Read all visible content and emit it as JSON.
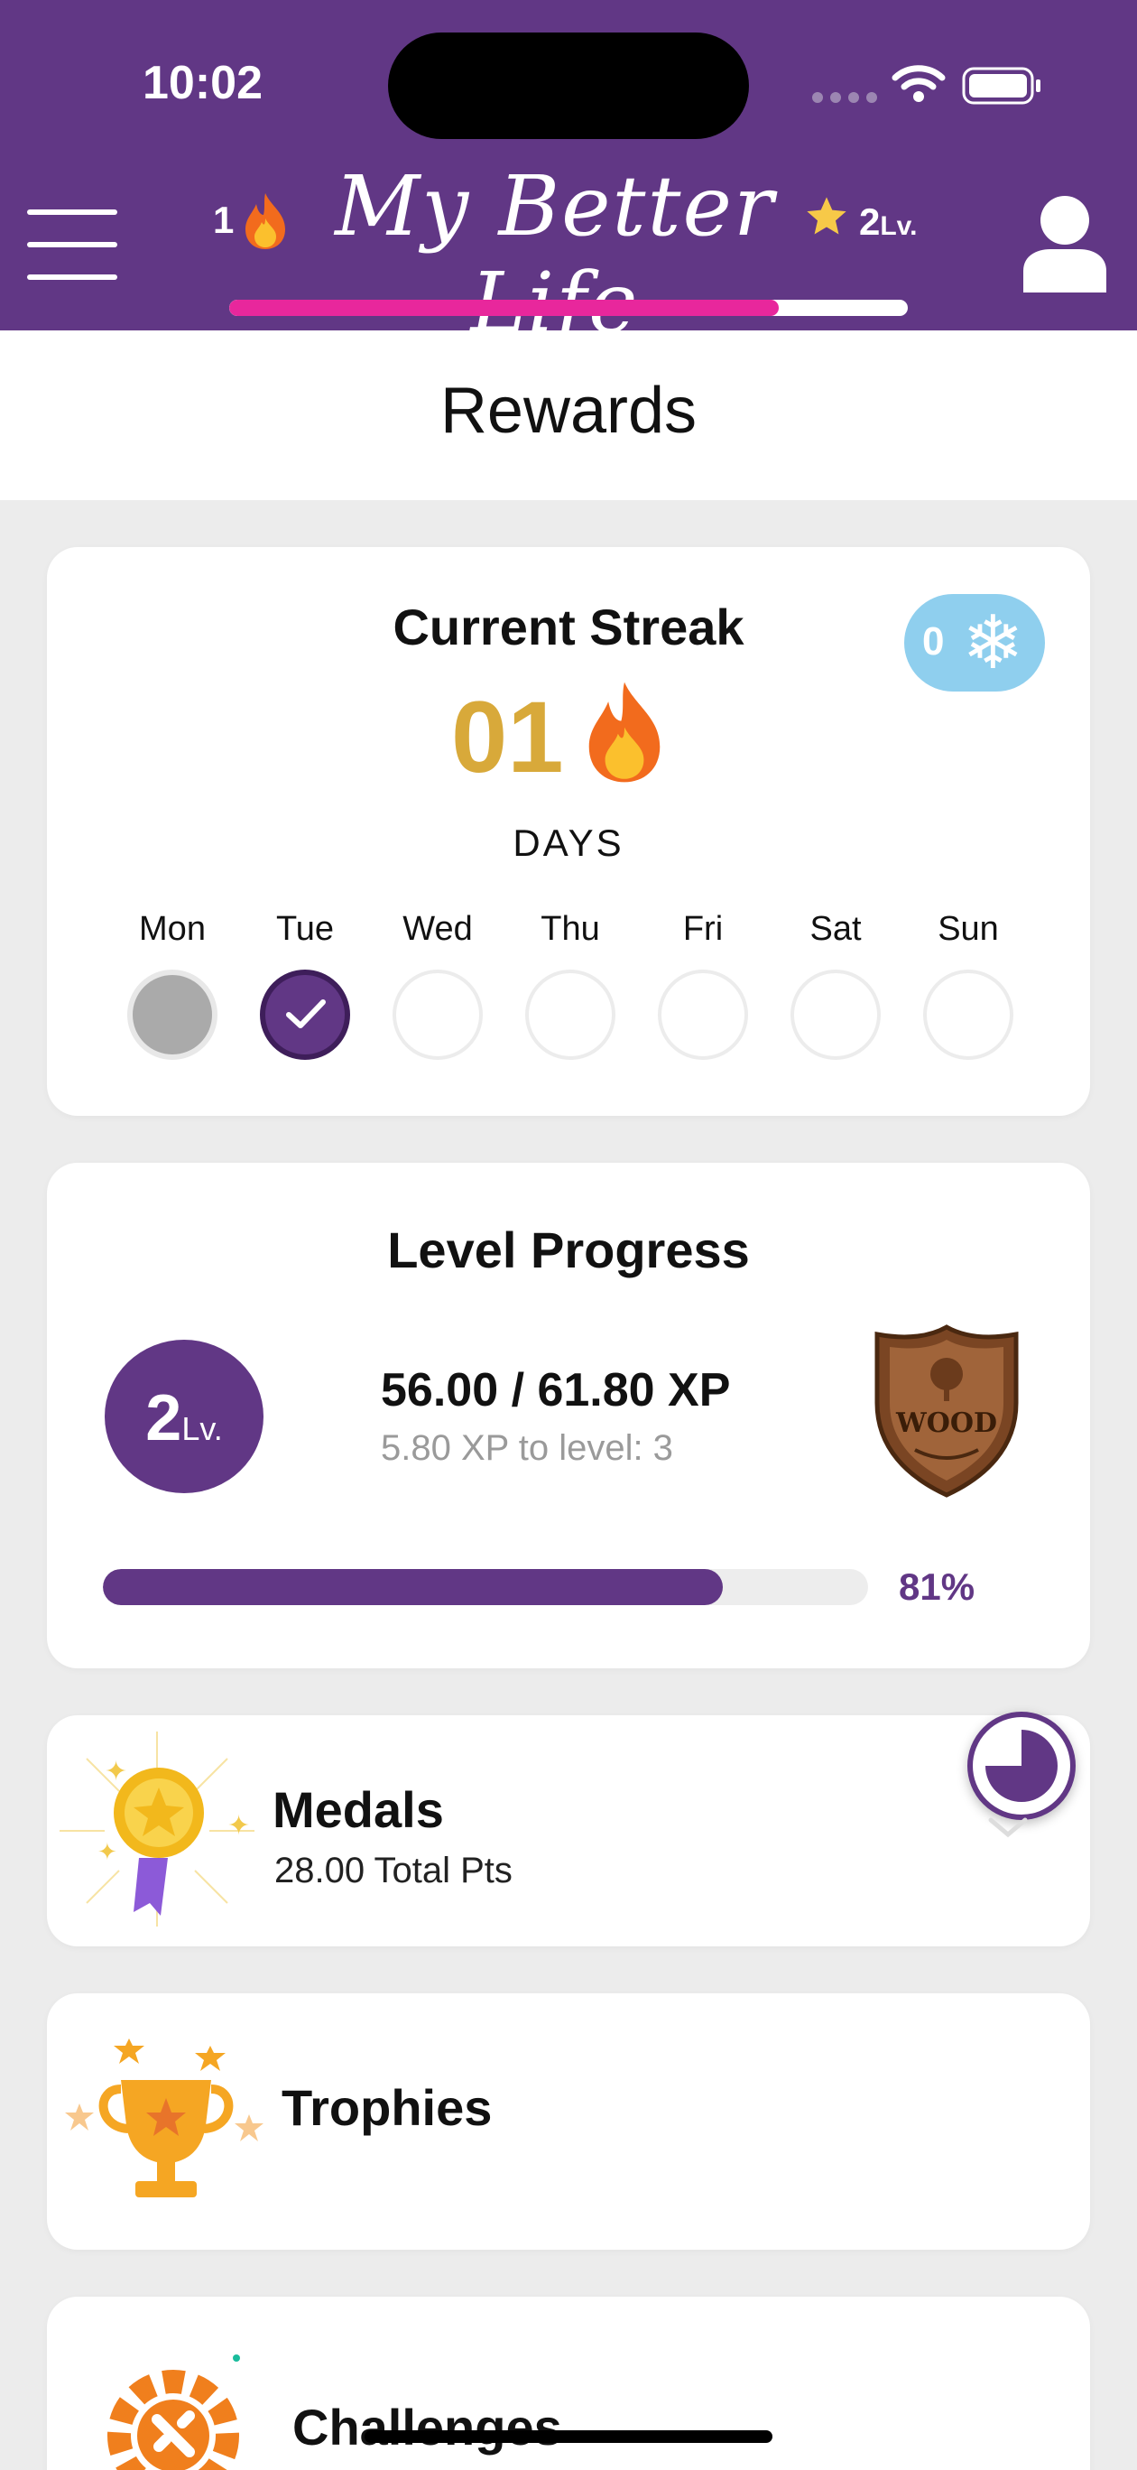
{
  "status_bar": {
    "time": "10:02"
  },
  "header": {
    "streak_count": "1",
    "brand_title": "My Better Life",
    "level_number": "2",
    "level_suffix": "Lv.",
    "xp_progress": 0.81
  },
  "page": {
    "title": "Rewards"
  },
  "streak_card": {
    "title": "Current Streak",
    "freeze_count": "0",
    "streak_value": "01",
    "days_label": "DAYS",
    "week": [
      {
        "label": "Mon",
        "state": "missed"
      },
      {
        "label": "Tue",
        "state": "done"
      },
      {
        "label": "Wed",
        "state": "empty"
      },
      {
        "label": "Thu",
        "state": "empty"
      },
      {
        "label": "Fri",
        "state": "empty"
      },
      {
        "label": "Sat",
        "state": "empty"
      },
      {
        "label": "Sun",
        "state": "empty"
      }
    ]
  },
  "level_card": {
    "title": "Level Progress",
    "level_number": "2",
    "level_suffix": "Lv.",
    "xp_text": "56.00 / 61.80 XP",
    "xp_to_next": "5.80 XP to level: 3",
    "badge_label": "WOOD",
    "progress": 0.81,
    "progress_label": "81%"
  },
  "medals": {
    "title": "Medals",
    "subtitle": "28.00 Total Pts"
  },
  "trophies": {
    "title": "Trophies"
  },
  "challenges": {
    "title": "Challenges"
  },
  "colors": {
    "brand_purple": "#613785",
    "xp_pink": "#e8279c",
    "streak_gold": "#d8a93a",
    "freeze_blue": "#8fcfee"
  }
}
